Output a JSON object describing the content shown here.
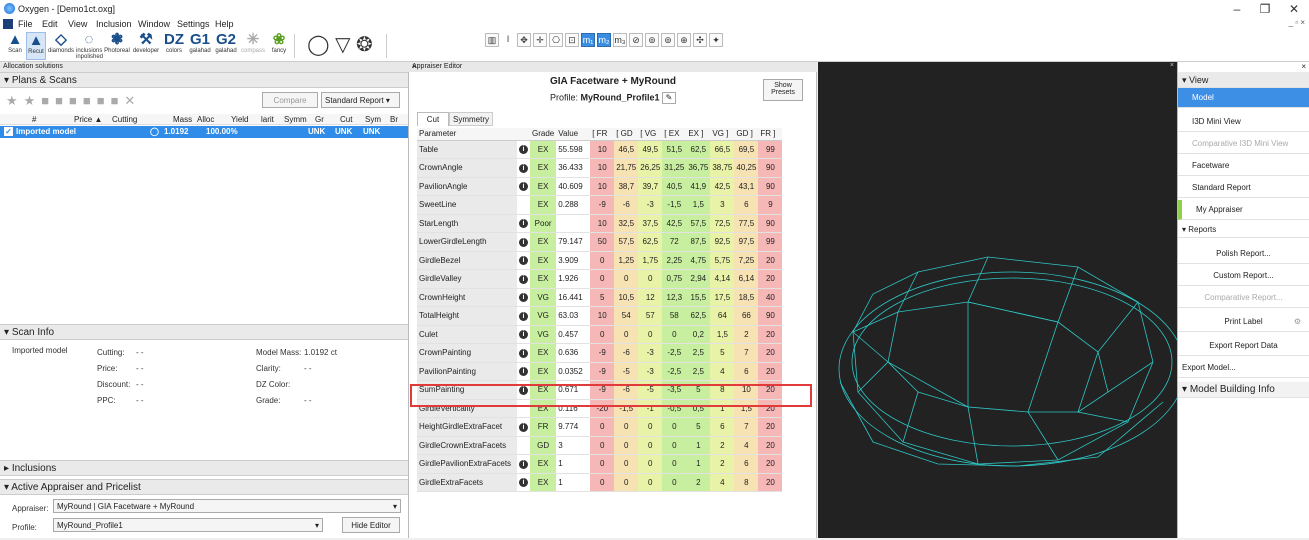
{
  "window": {
    "title": "Oxygen - [Demo1ct.oxg]",
    "min": "–",
    "max": "❐",
    "close": "✕",
    "mdi_controls": "_ ▫ ×"
  },
  "menu": [
    "File",
    "Edit",
    "View",
    "Inclusion",
    "Window",
    "Settings",
    "Help"
  ],
  "toolbar": [
    {
      "label": "Scan",
      "glyph": "▲"
    },
    {
      "label": "Recut",
      "glyph": "▲"
    },
    {
      "label": "diamonds",
      "glyph": "◇"
    },
    {
      "label": "inclusions inpolished",
      "glyph": "◌"
    },
    {
      "label": "Photoreal",
      "glyph": "❃"
    },
    {
      "label": "developer",
      "glyph": "⚒"
    },
    {
      "label": "colors",
      "glyph": "DZ"
    },
    {
      "label": "galahad",
      "glyph": "G1"
    },
    {
      "label": "galahad",
      "glyph": "G2"
    },
    {
      "label": "compass",
      "glyph": "✳"
    },
    {
      "label": "fancy",
      "glyph": "❀"
    }
  ],
  "toolbar_small": [
    "▥",
    "ǀ",
    "✥",
    "✛",
    "⎔",
    "⊡",
    "m₁",
    "m₂",
    "m₃",
    "⊘",
    "⊚",
    "⊚",
    "⊕",
    "✣",
    "✦"
  ],
  "left": {
    "header": "Allocation solutions",
    "plans_title": "Plans & Scans",
    "compare_btn": "Compare",
    "report_select": "Standard Report",
    "columns": [
      "#",
      "Price ▲",
      "Cutting",
      "Mass",
      "Alloc",
      "Yield",
      "larit",
      "Symm",
      "Gr",
      "Cut",
      "Sym",
      "Br"
    ],
    "row": {
      "name": "Imported model",
      "mass": "1.0192",
      "yield": "100.00%",
      "gr": "UNK",
      "cut": "UNK",
      "sym": "UNK"
    },
    "scan_info_title": "Scan Info",
    "scan": {
      "model": "Imported model",
      "cutting_lbl": "Cutting:",
      "cutting_val": "- -",
      "price_lbl": "Price:",
      "price_val": "- -",
      "discount_lbl": "Discount:",
      "discount_val": "- -",
      "ppc_lbl": "PPC:",
      "ppc_val": "- -",
      "mass_lbl": "Model Mass:",
      "mass_val": "1.0192 ct",
      "clarity_lbl": "Clarity:",
      "clarity_val": "- -",
      "dzcolor_lbl": "DZ Color:",
      "grade_lbl": "Grade:",
      "grade_val": "- -"
    },
    "inclusions_title": "Inclusions",
    "active_title": "Active Appraiser and Pricelist",
    "appraiser_lbl": "Appraiser:",
    "appraiser_val": "MyRound | GIA Facetware + MyRound",
    "profile_lbl": "Profile:",
    "profile_val": "MyRound_Profile1",
    "hide_editor": "Hide Editor"
  },
  "appraiser": {
    "header": "Appraiser Editor",
    "title": "GIA Facetware + MyRound",
    "profile_lbl": "Profile:",
    "profile_val": "MyRound_Profile1",
    "show_presets": "Show Presets",
    "tabs": [
      "Cut",
      "Symmetry"
    ],
    "columns": [
      "Parameter",
      "Grade",
      "Value",
      "[ FR",
      "[ GD",
      "[ VG",
      "[ EX",
      "EX ]",
      "VG ]",
      "GD ]",
      "FR ]"
    ],
    "rows": [
      {
        "name": "Table",
        "info": true,
        "grade": "EX",
        "value": "55.598",
        "t": [
          "10",
          "46,5",
          "49,5",
          "51,5",
          "62,5",
          "66,5",
          "69,5",
          "99"
        ]
      },
      {
        "name": "CrownAngle",
        "info": true,
        "grade": "EX",
        "value": "36.433",
        "t": [
          "10",
          "21,75",
          "26,25",
          "31,25",
          "36,75",
          "38,75",
          "40,25",
          "90"
        ]
      },
      {
        "name": "PavilionAngle",
        "info": true,
        "grade": "EX",
        "value": "40.609",
        "t": [
          "10",
          "38,7",
          "39,7",
          "40,5",
          "41,9",
          "42,5",
          "43,1",
          "90"
        ]
      },
      {
        "name": "SweetLine",
        "info": false,
        "grade": "EX",
        "value": "0.288",
        "t": [
          "-9",
          "-6",
          "-3",
          "-1,5",
          "1,5",
          "3",
          "6",
          "9"
        ]
      },
      {
        "name": "StarLength",
        "info": true,
        "grade": "Poor",
        "value": "",
        "t": [
          "10",
          "32,5",
          "37,5",
          "42,5",
          "57,5",
          "72,5",
          "77,5",
          "90"
        ]
      },
      {
        "name": "LowerGirdleLength",
        "info": true,
        "grade": "EX",
        "value": "79.147",
        "t": [
          "50",
          "57,5",
          "62,5",
          "72",
          "87,5",
          "92,5",
          "97,5",
          "99"
        ]
      },
      {
        "name": "GirdleBezel",
        "info": true,
        "grade": "EX",
        "value": "3.909",
        "t": [
          "0",
          "1,25",
          "1,75",
          "2,25",
          "4,75",
          "5,75",
          "7,25",
          "20"
        ]
      },
      {
        "name": "GirdleValley",
        "info": true,
        "grade": "EX",
        "value": "1.926",
        "t": [
          "0",
          "0",
          "0",
          "0,75",
          "2,94",
          "4,14",
          "6,14",
          "20"
        ]
      },
      {
        "name": "CrownHeight",
        "info": true,
        "grade": "VG",
        "value": "16.441",
        "t": [
          "5",
          "10,5",
          "12",
          "12,3",
          "15,5",
          "17,5",
          "18,5",
          "40"
        ]
      },
      {
        "name": "TotalHeight",
        "info": true,
        "grade": "VG",
        "value": "63.03",
        "t": [
          "10",
          "54",
          "57",
          "58",
          "62,5",
          "64",
          "66",
          "90"
        ]
      },
      {
        "name": "Culet",
        "info": true,
        "grade": "VG",
        "value": "0.457",
        "t": [
          "0",
          "0",
          "0",
          "0",
          "0,2",
          "1,5",
          "2",
          "20"
        ]
      },
      {
        "name": "CrownPainting",
        "info": true,
        "grade": "EX",
        "value": "0.636",
        "t": [
          "-9",
          "-6",
          "-3",
          "-2,5",
          "2,5",
          "5",
          "7",
          "20"
        ]
      },
      {
        "name": "PavilionPainting",
        "info": true,
        "grade": "EX",
        "value": "0.0352",
        "t": [
          "-9",
          "-5",
          "-3",
          "-2,5",
          "2,5",
          "4",
          "6",
          "20"
        ]
      },
      {
        "name": "SumPainting",
        "info": true,
        "grade": "EX",
        "value": "0.671",
        "t": [
          "-9",
          "-6",
          "-5",
          "-3,5",
          "5",
          "8",
          "10",
          "20"
        ]
      },
      {
        "name": "GirdleVerticality",
        "info": false,
        "grade": "EX",
        "value": "0.116",
        "t": [
          "-20",
          "-1,5",
          "-1",
          "-0,5",
          "0,5",
          "1",
          "1,5",
          "20"
        ]
      },
      {
        "name": "HeightGirdleExtraFacet",
        "info": true,
        "grade": "FR",
        "value": "9.774",
        "t": [
          "0",
          "0",
          "0",
          "0",
          "5",
          "6",
          "7",
          "20"
        ]
      },
      {
        "name": "GirdleCrownExtraFacets",
        "info": false,
        "grade": "GD",
        "value": "3",
        "t": [
          "0",
          "0",
          "0",
          "0",
          "1",
          "2",
          "4",
          "20"
        ]
      },
      {
        "name": "GirdlePavilionExtraFacets",
        "info": true,
        "grade": "EX",
        "value": "1",
        "t": [
          "0",
          "0",
          "0",
          "0",
          "1",
          "2",
          "6",
          "20"
        ]
      },
      {
        "name": "GirdleExtraFacets",
        "info": true,
        "grade": "EX",
        "value": "1",
        "t": [
          "0",
          "0",
          "0",
          "0",
          "2",
          "4",
          "8",
          "20"
        ]
      }
    ],
    "colors": {
      "fr": "#f6b7b7",
      "gd": "#f7e2b4",
      "vg": "#e9f3a8",
      "ex": "#c8ef9f",
      "name": "#eaeaea"
    }
  },
  "right": {
    "view_title": "View",
    "view_items": [
      "Model",
      "I3D Mini View",
      "Comparative I3D Mini View",
      "Facetware",
      "Standard Report",
      "My Appraiser"
    ],
    "reports_title": "Reports",
    "report_items": [
      "Polish Report...",
      "Custom Report...",
      "Comparative Report...",
      "Print Label",
      "Export Report Data"
    ],
    "export_model": "Export Model...",
    "mbi_title": "Model Building Info",
    "accent": "#3d8fe6"
  }
}
